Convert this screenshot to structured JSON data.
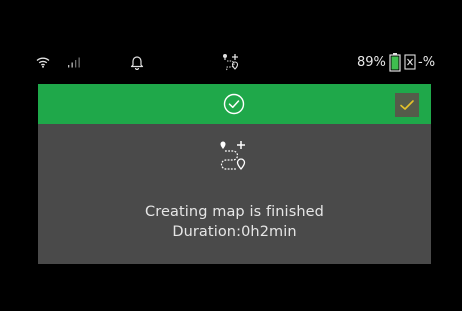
{
  "status_bar": {
    "battery_percent": "89%",
    "suffix_text": "-%",
    "icons": [
      "wifi-icon",
      "signal-bars-icon",
      "bell-icon",
      "map-route-icon",
      "battery-icon",
      "close-box-icon"
    ]
  },
  "dialog": {
    "header_icon": "check-circle-icon",
    "confirm_icon": "checkmark-icon",
    "body_icon": "map-route-icon",
    "message_line1": "Creating map is finished",
    "message_line2": "Duration:0h2min"
  },
  "colors": {
    "header_green": "#1fa84a",
    "dialog_gray": "#4a4a4a",
    "confirm_bg": "#555b4a",
    "confirm_check": "#e6c32a",
    "battery_green": "#3fbf4f"
  }
}
